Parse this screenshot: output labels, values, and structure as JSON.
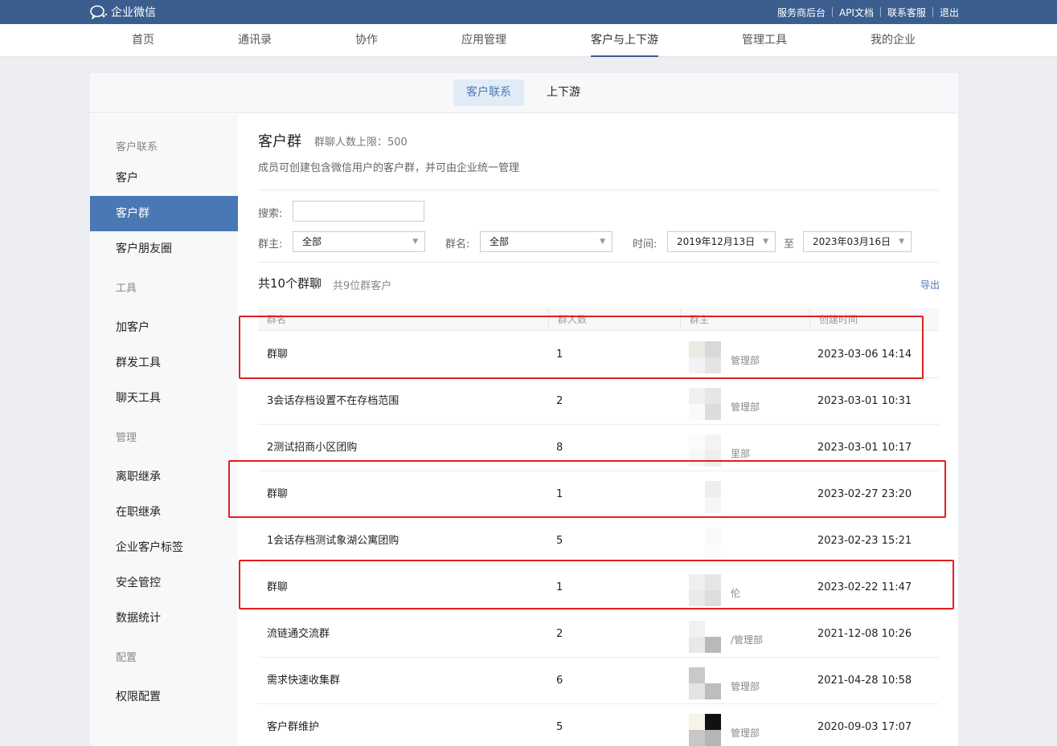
{
  "app": {
    "logo_text": "企业微信"
  },
  "top_links": [
    "服务商后台",
    "API文档",
    "联系客服",
    "退出"
  ],
  "nav": [
    {
      "label": "首页"
    },
    {
      "label": "通讯录"
    },
    {
      "label": "协作"
    },
    {
      "label": "应用管理"
    },
    {
      "label": "客户与上下游",
      "active": true
    },
    {
      "label": "管理工具"
    },
    {
      "label": "我的企业"
    }
  ],
  "subtabs": [
    {
      "label": "客户联系",
      "active": true
    },
    {
      "label": "上下游"
    }
  ],
  "sidebar": {
    "sections": [
      {
        "heading": "客户联系",
        "items": [
          "客户",
          "客户群",
          "客户朋友圈"
        ]
      },
      {
        "heading": "工具",
        "items": [
          "加客户",
          "群发工具",
          "聊天工具"
        ]
      },
      {
        "heading": "管理",
        "items": [
          "离职继承",
          "在职继承",
          "企业客户标签",
          "安全管控",
          "数据统计"
        ]
      },
      {
        "heading": "配置",
        "items": [
          "权限配置"
        ]
      }
    ],
    "active_item": "客户群"
  },
  "page": {
    "title": "客户群",
    "limit_text": "群聊人数上限：500",
    "description": "成员可创建包含微信用户的客户群，并可由企业统一管理"
  },
  "filters": {
    "search_label": "搜索:",
    "search_value": "",
    "owner_label": "群主:",
    "owner_value": "全部",
    "group_label": "群名:",
    "group_value": "全部",
    "time_label": "时间:",
    "time_from": "2019年12月13日",
    "time_sep": "至",
    "time_to": "2023年03月16日"
  },
  "summary": {
    "count_text": "共10个群聊",
    "customers_text": "共9位群客户",
    "export_label": "导出"
  },
  "table": {
    "headers": [
      "群名",
      "群人数",
      "群主",
      "创建时间"
    ],
    "rows": [
      {
        "name": "群聊",
        "members": "1",
        "dept": "管理部",
        "created": "2023-03-06 14:14",
        "highlighted": true
      },
      {
        "name": "3会话存档设置不在存档范围",
        "members": "2",
        "dept": "管理部",
        "created": "2023-03-01 10:31"
      },
      {
        "name": "2测试招商小区团购",
        "members": "8",
        "dept": "里部",
        "created": "2023-03-01 10:17"
      },
      {
        "name": "群聊",
        "members": "1",
        "dept": "",
        "created": "2023-02-27 23:20",
        "highlighted": true
      },
      {
        "name": "1会话存档测试象湖公寓团购",
        "members": "5",
        "dept": "",
        "created": "2023-02-23 15:21"
      },
      {
        "name": "群聊",
        "members": "1",
        "dept": "伦",
        "created": "2023-02-22 11:47",
        "highlighted": true
      },
      {
        "name": "流链通交流群",
        "members": "2",
        "dept": "/管理部",
        "created": "2021-12-08 10:26"
      },
      {
        "name": "需求快速收集群",
        "members": "6",
        "dept": "管理部",
        "created": "2021-04-28 10:58"
      },
      {
        "name": "客户群维护",
        "members": "5",
        "dept": "管理部",
        "created": "2020-09-03 17:07"
      }
    ]
  },
  "colors": {
    "topbar": "#3c5e8f",
    "active_side": "#4a78b4",
    "highlight_box": "#e21f1f",
    "link": "#4a78b4"
  }
}
